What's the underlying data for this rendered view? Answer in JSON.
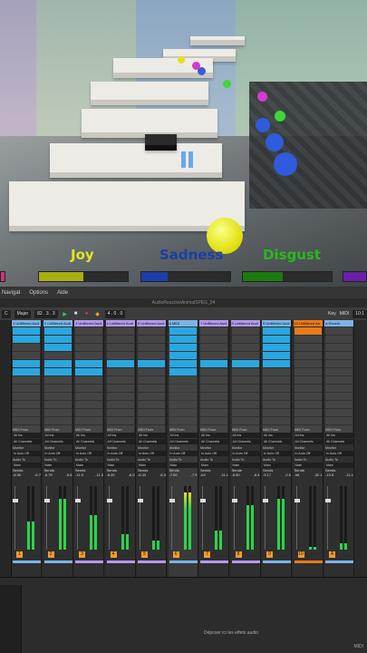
{
  "game": {
    "emotions": [
      {
        "label": "Joy",
        "color": "#e5e61a",
        "bar_color": "#a8ad12",
        "level": 0.5
      },
      {
        "label": "Sadness",
        "color": "#1b3ea8",
        "bar_color": "#1b3ea8",
        "level": 0.3
      },
      {
        "label": "Disgust",
        "color": "#2ab81d",
        "bar_color": "#1b7a10",
        "level": 0.45
      }
    ]
  },
  "daw": {
    "menu": [
      "Navigat",
      "Options",
      "Aide"
    ],
    "window_title": "AudioReactiveAnimalSPEG_04",
    "transport": {
      "key": "C",
      "scale": "Major",
      "tempo": "82 . 3 . 3",
      "bars": "4 . 0 . 0",
      "key_label": "Key",
      "midi_label": "MIDI",
      "cpu": "10:1"
    },
    "tracks": [
      {
        "name": "1 Unfiltered Audi",
        "head": "#7bb3e8",
        "db": "-6.30",
        "db2": "-6.7",
        "level": 0.45,
        "num": "1"
      },
      {
        "name": "2 Unfiltered Audi",
        "head": "#7bb3e8",
        "db": "-6.79",
        "db2": "-9.8",
        "level": 0.8,
        "num": "2"
      },
      {
        "name": "3 Unfiltered Audi",
        "head": "#b39af0",
        "db": "-11.5",
        "db2": "-11.5",
        "level": 0.55,
        "num": "3"
      },
      {
        "name": "4 Unfiltered Audi",
        "head": "#b39af0",
        "db": "-6.00",
        "db2": "-6.0",
        "level": 0.25,
        "num": "4"
      },
      {
        "name": "5 Unfiltered Audi",
        "head": "#b39af0",
        "db": "-6.33",
        "db2": "-6.3",
        "level": 0.15,
        "num": "5"
      },
      {
        "name": "6 MIDI",
        "head": "#7bb3e8",
        "db": "-7.00",
        "db2": "-7.5",
        "level": 0.9,
        "num": "6"
      },
      {
        "name": "7 Unfiltered Audi",
        "head": "#b39af0",
        "db": "-inf",
        "db2": "-11.1",
        "level": 0.3,
        "num": "7"
      },
      {
        "name": "8 Unfiltered Audi",
        "head": "#b39af0",
        "db": "-6.50",
        "db2": "-8.4",
        "level": 0.7,
        "num": "8"
      },
      {
        "name": "9 Unfiltered Audi",
        "head": "#7bb3e8",
        "db": "-5.17",
        "db2": "-2.5",
        "level": 0.8,
        "num": "9"
      },
      {
        "name": "10 Unfiltered Au",
        "head": "#e87b1c",
        "db": "-inf",
        "db2": "-32.1",
        "level": 0.05,
        "num": "10"
      },
      {
        "name": "A Reverb",
        "head": "#7bb3e8",
        "db": "-13.5",
        "db2": "-11.1",
        "level": 0.1,
        "num": "A"
      }
    ],
    "io_labels": {
      "midi_from": "MIDI From",
      "all_ins": "All Ins",
      "all_channels": "All Channels",
      "monitor": "Monitor",
      "in": "In",
      "auto": "Auto",
      "off": "Off",
      "audio_to": "Audio To",
      "main": "Main",
      "sends": "Sends"
    },
    "drop_text": "Déposer ici les effets audio",
    "status": "MIDI"
  }
}
